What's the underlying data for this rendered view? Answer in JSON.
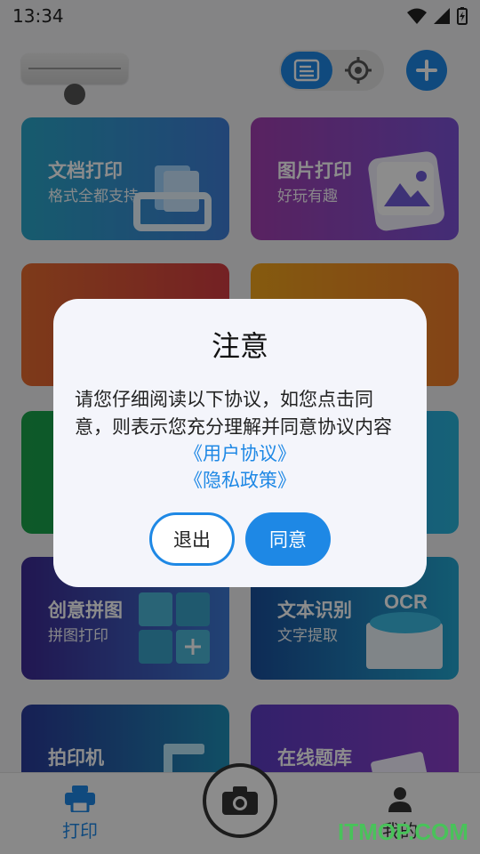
{
  "status_bar": {
    "time": "13:34"
  },
  "cards": [
    {
      "title": "文档打印",
      "subtitle": "格式全都支持"
    },
    {
      "title": "图片打印",
      "subtitle": "好玩有趣"
    },
    {
      "title": "",
      "subtitle": ""
    },
    {
      "title": "",
      "subtitle": ""
    },
    {
      "title": "",
      "subtitle": ""
    },
    {
      "title": "",
      "subtitle": ""
    },
    {
      "title": "创意拼图",
      "subtitle": "拼图打印"
    },
    {
      "title": "文本识别",
      "subtitle": "文字提取"
    },
    {
      "title": "拍印机",
      "subtitle": ""
    },
    {
      "title": "在线题库",
      "subtitle": ""
    }
  ],
  "card_art_text": {
    "ocr": "OCR"
  },
  "bottom_nav": {
    "print_label": "打印",
    "mine_label": "我的"
  },
  "dialog": {
    "title": "注意",
    "body": "请您仔细阅读以下协议，如您点击同意，则表示您充分理解并同意协议内容",
    "link_user_agreement": "《用户协议》",
    "link_privacy_policy": "《隐私政策》",
    "exit_label": "退出",
    "agree_label": "同意"
  },
  "watermark": "ITMOP.COM",
  "colors": {
    "accent": "#1e88e5",
    "watermark": "#49c25a"
  }
}
